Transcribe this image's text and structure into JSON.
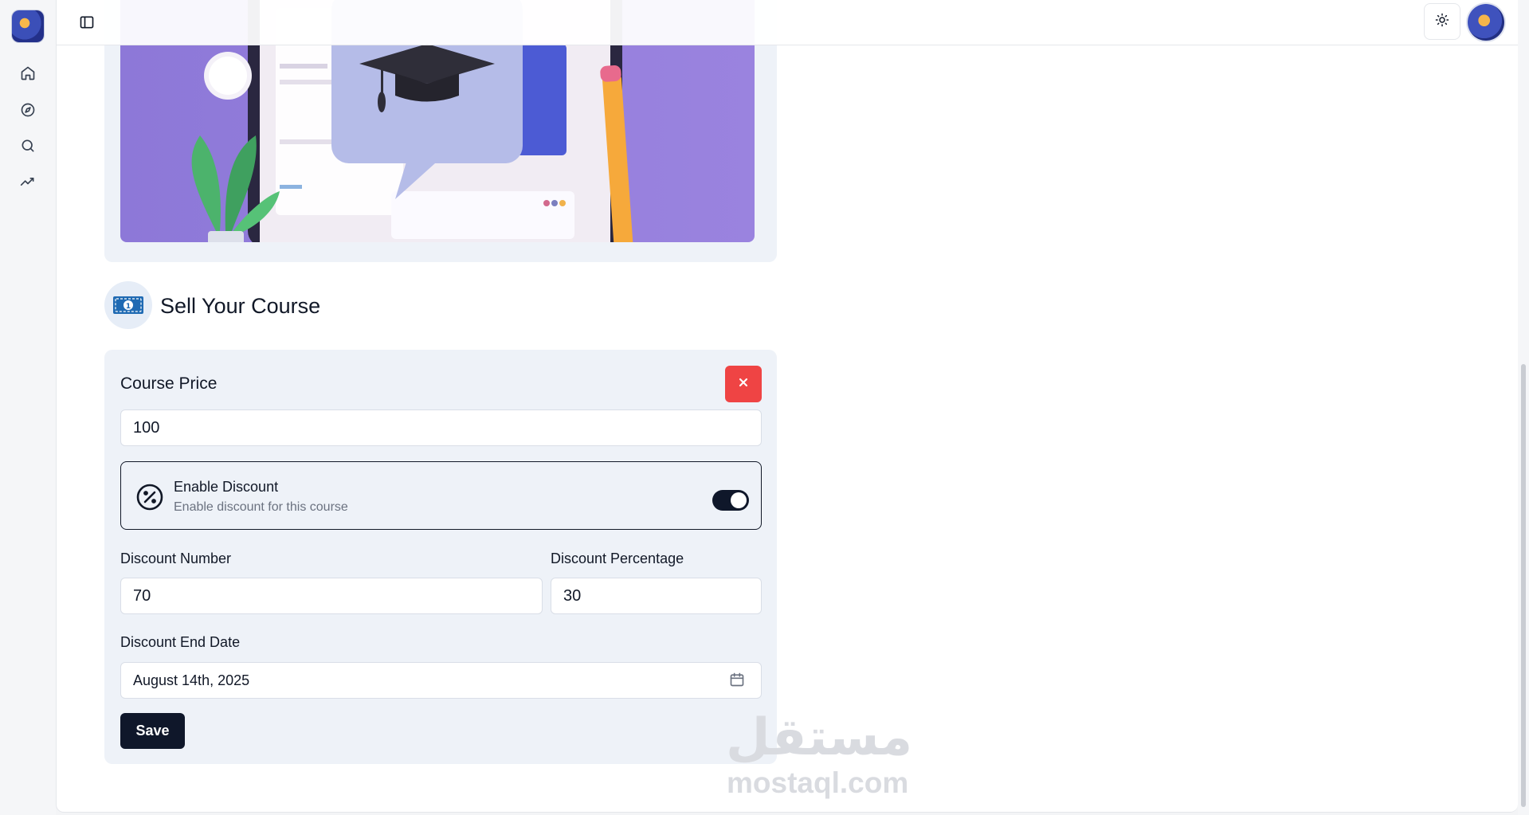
{
  "rail": {
    "logo": "app-logo",
    "items": [
      {
        "name": "home-icon"
      },
      {
        "name": "compass-icon"
      },
      {
        "name": "search-icon"
      },
      {
        "name": "trending-icon"
      }
    ]
  },
  "header": {
    "sidebar_toggle_icon": "panel-left-icon",
    "theme_icon": "sun-icon"
  },
  "section": {
    "title": "Sell Your Course",
    "icon": "banknote-icon"
  },
  "form": {
    "course_price_label": "Course Price",
    "course_price_value": "100",
    "discount": {
      "title": "Enable Discount",
      "subtitle": "Enable discount for this course",
      "enabled": true
    },
    "discount_number_label": "Discount Number",
    "discount_number_value": "70",
    "discount_percentage_label": "Discount Percentage",
    "discount_percentage_value": "30",
    "discount_end_date_label": "Discount End Date",
    "discount_end_date_value": "August 14th, 2025",
    "save_label": "Save"
  },
  "watermark": {
    "arabic": "مستقل",
    "latin": "mostaql.com"
  },
  "colors": {
    "primary": "#0f172a",
    "danger": "#ef4444",
    "panel": "#eef2f8",
    "hero_purple": "#8e77d6"
  }
}
